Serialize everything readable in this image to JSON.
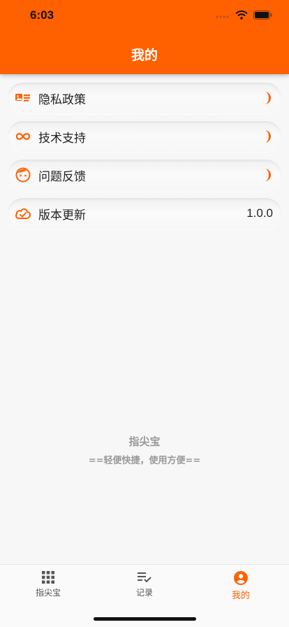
{
  "status_bar": {
    "time": "6:03"
  },
  "header": {
    "title": "我的"
  },
  "menu": {
    "items": [
      {
        "label": "隐私政策",
        "icon": "privacy-card-icon"
      },
      {
        "label": "技术支持",
        "icon": "infinity-icon"
      },
      {
        "label": "问题反馈",
        "icon": "face-icon"
      },
      {
        "label": "版本更新",
        "icon": "cloud-check-icon",
        "value": "1.0.0"
      }
    ]
  },
  "footer": {
    "title": "指尖宝",
    "subtitle": "==轻便快捷，使用方便=="
  },
  "tabbar": {
    "tabs": [
      {
        "label": "指尖宝",
        "icon": "grid-icon"
      },
      {
        "label": "记录",
        "icon": "list-check-icon"
      },
      {
        "label": "我的",
        "icon": "account-circle-icon"
      }
    ],
    "active": "我的"
  },
  "colors": {
    "accent": "#ff6000",
    "background": "#f7f7f7",
    "footer_text": "#999999"
  }
}
